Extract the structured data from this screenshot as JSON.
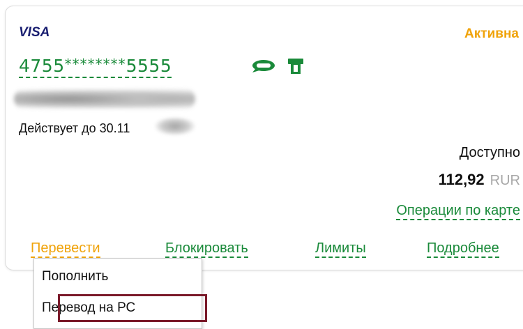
{
  "card": {
    "brand": "VISA",
    "status": "Активна",
    "number_prefix": "4755",
    "number_masked": "********",
    "number_suffix": "5555",
    "expiry_label": "Действует до 30.11",
    "available_label": "Доступно",
    "balance_amount": "112,92",
    "balance_currency": "RUR",
    "operations_link": "Операции по карте",
    "icons": [
      "sms-icon",
      "atm-icon"
    ]
  },
  "actions": {
    "transfer": "Перевести",
    "block": "Блокировать",
    "limits": "Лимиты",
    "details": "Подробнее"
  },
  "dropdown": {
    "items": [
      {
        "label": "Пополнить"
      },
      {
        "label": "Перевод на РС",
        "highlighted": true
      }
    ]
  },
  "colors": {
    "green": "#1a8a3a",
    "orange": "#f0a30a",
    "visa_blue": "#1a1f71",
    "highlight_border": "#7a1a2a"
  }
}
